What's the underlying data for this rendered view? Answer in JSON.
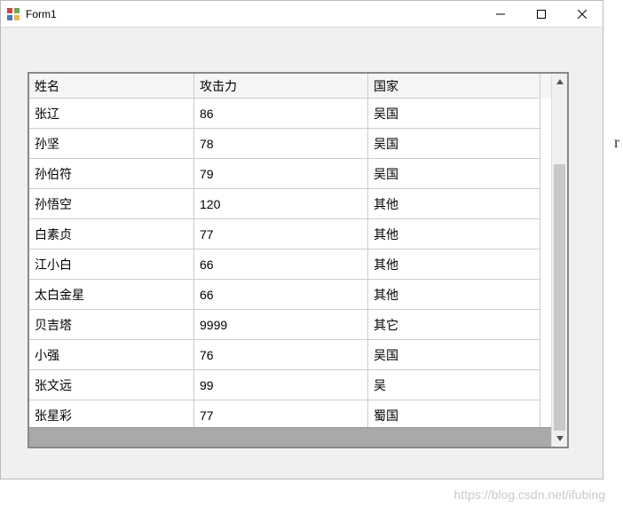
{
  "window": {
    "title": "Form1"
  },
  "grid": {
    "headers": {
      "name": "姓名",
      "attack": "攻击力",
      "country": "国家"
    },
    "rows": [
      {
        "name": "张辽",
        "attack": "86",
        "country": "吴国"
      },
      {
        "name": "孙坚",
        "attack": "78",
        "country": "吴国"
      },
      {
        "name": "孙伯符",
        "attack": "79",
        "country": "吴国"
      },
      {
        "name": "孙悟空",
        "attack": "120",
        "country": "其他"
      },
      {
        "name": "白素贞",
        "attack": "77",
        "country": "其他"
      },
      {
        "name": "江小白",
        "attack": "66",
        "country": "其他"
      },
      {
        "name": "太白金星",
        "attack": "66",
        "country": "其他"
      },
      {
        "name": "贝吉塔",
        "attack": "9999",
        "country": "其它"
      },
      {
        "name": "小强",
        "attack": "76",
        "country": "吴国"
      },
      {
        "name": "张文远",
        "attack": "99",
        "country": "吴"
      },
      {
        "name": "张星彩",
        "attack": "77",
        "country": "蜀国"
      }
    ]
  },
  "scrollbar": {
    "thumb_top_pct": 22,
    "thumb_height_pct": 78
  },
  "watermark": "https://blog.csdn.net/ifubing",
  "cursor_char": "r"
}
